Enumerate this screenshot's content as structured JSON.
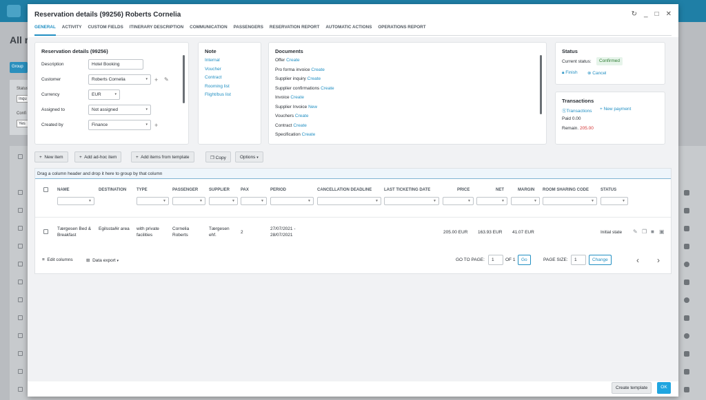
{
  "background": {
    "page_title_partial": "All r",
    "group_button": "Group",
    "status_label": "Status",
    "status_value": "Inqu",
    "confirmed_label": "Confi",
    "confirmed_value": "Yes"
  },
  "dialog": {
    "title": "Reservation details (99256) Roberts Cornelia",
    "controls": [
      "refresh-icon",
      "minimize-icon",
      "maximize-icon",
      "close-icon"
    ],
    "tabs": [
      "GENERAL",
      "ACTIVITY",
      "CUSTOM FIELDS",
      "ITINERARY DESCRIPTION",
      "COMMUNICATION",
      "PASSENGERS",
      "RESERVATION REPORT",
      "AUTOMATIC ACTIONS",
      "OPERATIONS REPORT"
    ]
  },
  "details": {
    "title": "Reservation details (99256)",
    "fields": [
      {
        "label": "Description",
        "value": "Hotel Booking"
      },
      {
        "label": "Customer",
        "value": "Roberts Cornelia"
      },
      {
        "label": "Currency",
        "value": "EUR"
      },
      {
        "label": "Assigned to",
        "value": "Not assigned"
      },
      {
        "label": "Created by",
        "value": "Finance"
      }
    ]
  },
  "note": {
    "title": "Note",
    "items": [
      "Internal",
      "Voucher",
      "Contract",
      "Rooming list",
      "Flight/bus list"
    ]
  },
  "documents": {
    "title": "Documents",
    "rows": [
      {
        "label": "Offer",
        "action": "Create"
      },
      {
        "label": "Pro forma invoice",
        "action": "Create"
      },
      {
        "label": "Supplier inquiry",
        "action": "Create"
      },
      {
        "label": "Supplier confirmations",
        "action": "Create"
      },
      {
        "label": "Invoice",
        "action": "Create"
      },
      {
        "label": "Supplier Invoice",
        "action": "New"
      },
      {
        "label": "Vouchers",
        "action": "Create"
      },
      {
        "label": "Contract",
        "action": "Create"
      },
      {
        "label": "Specification",
        "action": "Create"
      }
    ]
  },
  "status": {
    "title": "Status",
    "current_label": "Current status:",
    "current_value": "Confirmed",
    "finish": "Finish",
    "cancel": "Cancel",
    "accent": "#1f8ec2",
    "badge_bg": "#e6f4ea",
    "badge_fg": "#2e7d32"
  },
  "transactions": {
    "title": "Transactions",
    "link": "Transactions",
    "new_payment": "New payment",
    "paid": "Paid 0.00",
    "remain_label": "Remain.",
    "remain_value": "205.00",
    "remain_color": "#d32f2f"
  },
  "toolbar": {
    "new_item": "New item",
    "ad_hoc": "Add ad-hoc item",
    "from_template": "Add items from template",
    "copy": "Copy",
    "options": "Options"
  },
  "grid": {
    "group_hint": "Drag a column header and drop it here to group by that column",
    "columns": [
      "NAME",
      "DESTINATION",
      "TYPE",
      "PASSENGER",
      "SUPPLIER",
      "PAX",
      "PERIOD",
      "CANCELLATION DEADLINE",
      "LAST TICKETING DATE",
      "PRICE",
      "NET",
      "MARGIN",
      "ROOM SHARING CODE",
      "STATUS"
    ],
    "row": {
      "name": "Tærgesen Bed & Breakfast",
      "destination": "Egilsstaðir area",
      "type": "with private facilities",
      "passenger": "Cornelia Roberts",
      "supplier": "Tærgesen ehf.",
      "pax": "2",
      "period": "27/07/2021 - 28/07/2021",
      "price": "205.00 EUR",
      "net": "163.93 EUR",
      "margin": "41.07 EUR",
      "status": "Initial state"
    },
    "edit_columns": "Edit columns",
    "data_export": "Data export",
    "go_to_page_label": "GO TO PAGE:",
    "page_value": "1",
    "of_pages": "OF 1",
    "go": "Go",
    "page_size_label": "PAGE SIZE:",
    "page_size_value": "1",
    "change": "Change"
  },
  "footer": {
    "create_template": "Create template",
    "ok": "OK"
  }
}
